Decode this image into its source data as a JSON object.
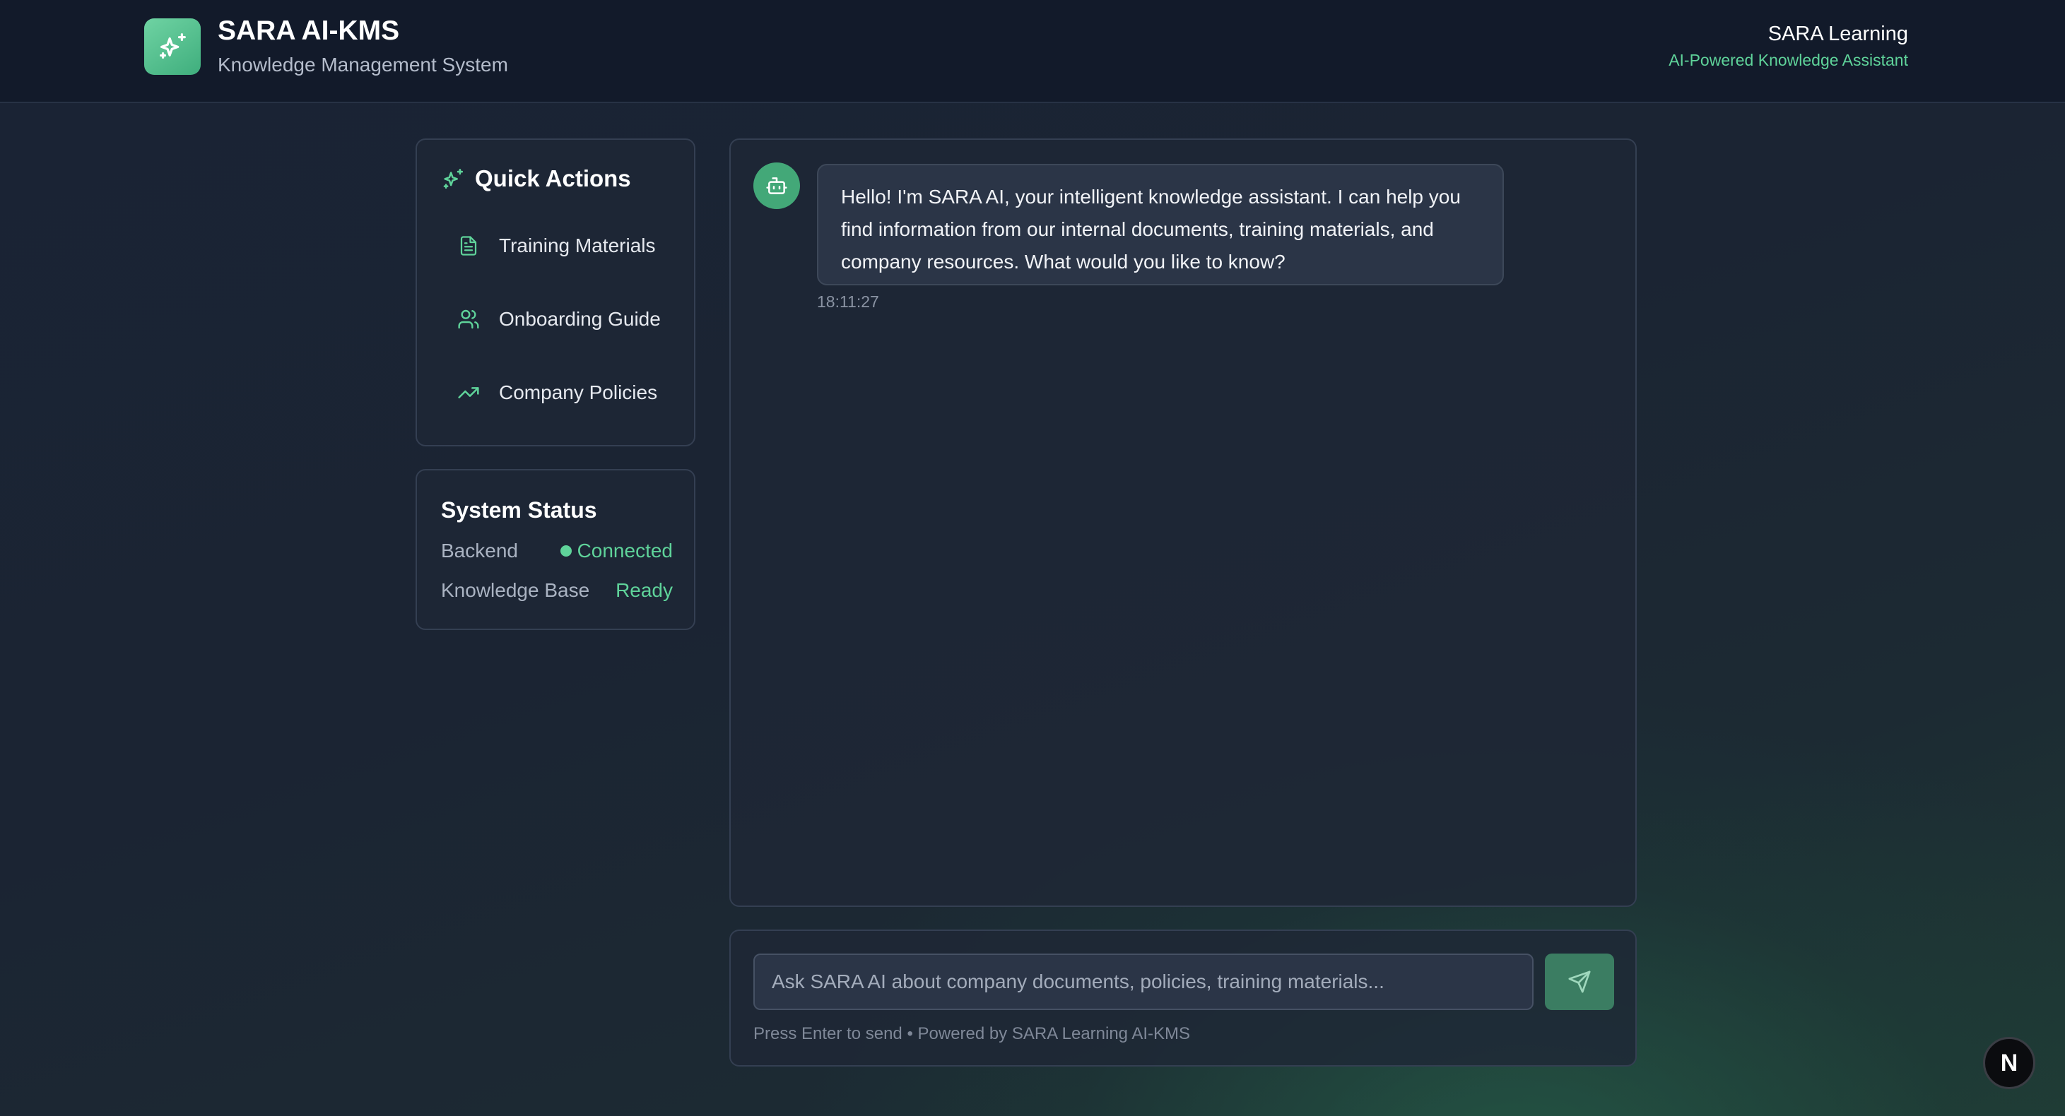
{
  "header": {
    "title": "SARA AI-KMS",
    "subtitle": "Knowledge Management System",
    "brand_name": "SARA Learning",
    "brand_tagline": "AI-Powered Knowledge Assistant",
    "logo_icon": "sparkles-icon"
  },
  "quick_actions": {
    "title": "Quick Actions",
    "title_icon": "sparkles-icon",
    "items": [
      {
        "label": "Training Materials",
        "icon": "document-icon"
      },
      {
        "label": "Onboarding Guide",
        "icon": "users-icon"
      },
      {
        "label": "Company Policies",
        "icon": "trending-up-icon"
      }
    ]
  },
  "system_status": {
    "title": "System Status",
    "rows": [
      {
        "label": "Backend",
        "value": "Connected"
      },
      {
        "label": "Knowledge Base",
        "value": "Ready"
      }
    ]
  },
  "chat": {
    "messages": [
      {
        "sender": "bot",
        "avatar_icon": "bot-icon",
        "text": "Hello! I'm SARA AI, your intelligent knowledge assistant. I can help you find information from our internal documents, training materials, and company resources. What would you like to know?",
        "time": "18:11:27"
      }
    ]
  },
  "composer": {
    "placeholder": "Ask SARA AI about company documents, policies, training materials...",
    "value": "",
    "send_icon": "send-icon",
    "hint": "Press Enter to send • Powered by SARA Learning AI-KMS"
  },
  "overlay": {
    "badge_letter": "N"
  },
  "colors": {
    "accent": "#5fd39a",
    "header_bg": "#121a2a",
    "panel_bg": "#1e2736",
    "send_button": "#3b7d62"
  }
}
